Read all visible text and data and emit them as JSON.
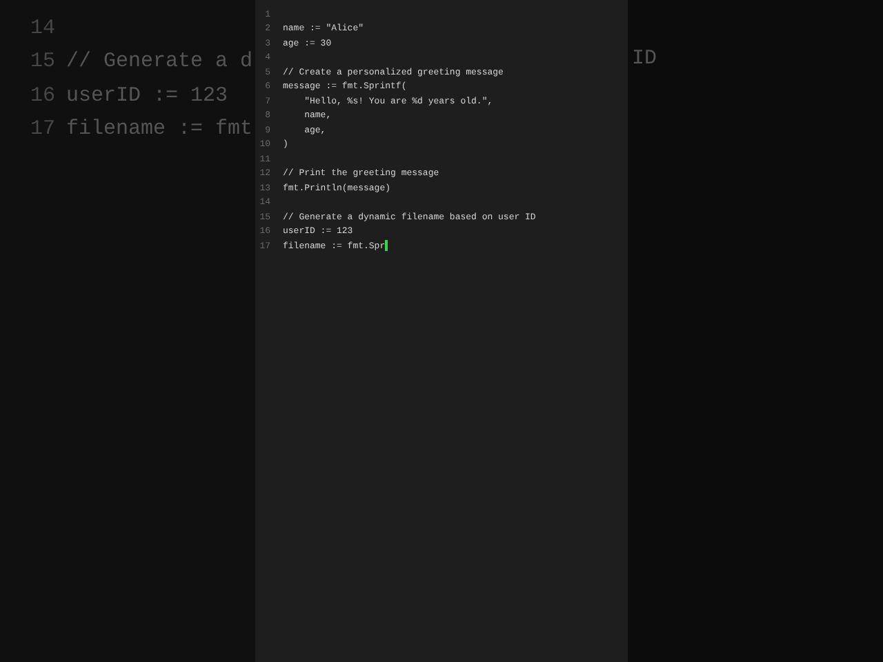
{
  "backdrop": {
    "left_lines": [
      {
        "number": "14"
      },
      {
        "number": "15",
        "text": "// Generate a d"
      },
      {
        "number": "16",
        "text": "userID := 123"
      },
      {
        "number": "17",
        "text": "filename := fmt"
      }
    ],
    "right_text": "ID"
  },
  "editor": {
    "lines": [
      {
        "number": "1"
      },
      {
        "number": "2",
        "text": "name := \"Alice\""
      },
      {
        "number": "3",
        "text": "age := 30"
      },
      {
        "number": "4"
      },
      {
        "number": "5",
        "text": "// Create a personalized greeting message"
      },
      {
        "number": "6",
        "text": "message := fmt.Sprintf("
      },
      {
        "number": "7",
        "text": "    \"Hello, %s! You are %d years old.\","
      },
      {
        "number": "8",
        "text": "    name,"
      },
      {
        "number": "9",
        "text": "    age,"
      },
      {
        "number": "10",
        "text": ")"
      },
      {
        "number": "11"
      },
      {
        "number": "12",
        "text": "// Print the greeting message"
      },
      {
        "number": "13",
        "text": "fmt.Println(message)"
      },
      {
        "number": "14"
      },
      {
        "number": "15",
        "text": "// Generate a dynamic filename based on user ID"
      },
      {
        "number": "16",
        "text": "userID := 123"
      },
      {
        "number": "17",
        "text": "filename := fmt.Spr",
        "cursor": true
      }
    ]
  }
}
